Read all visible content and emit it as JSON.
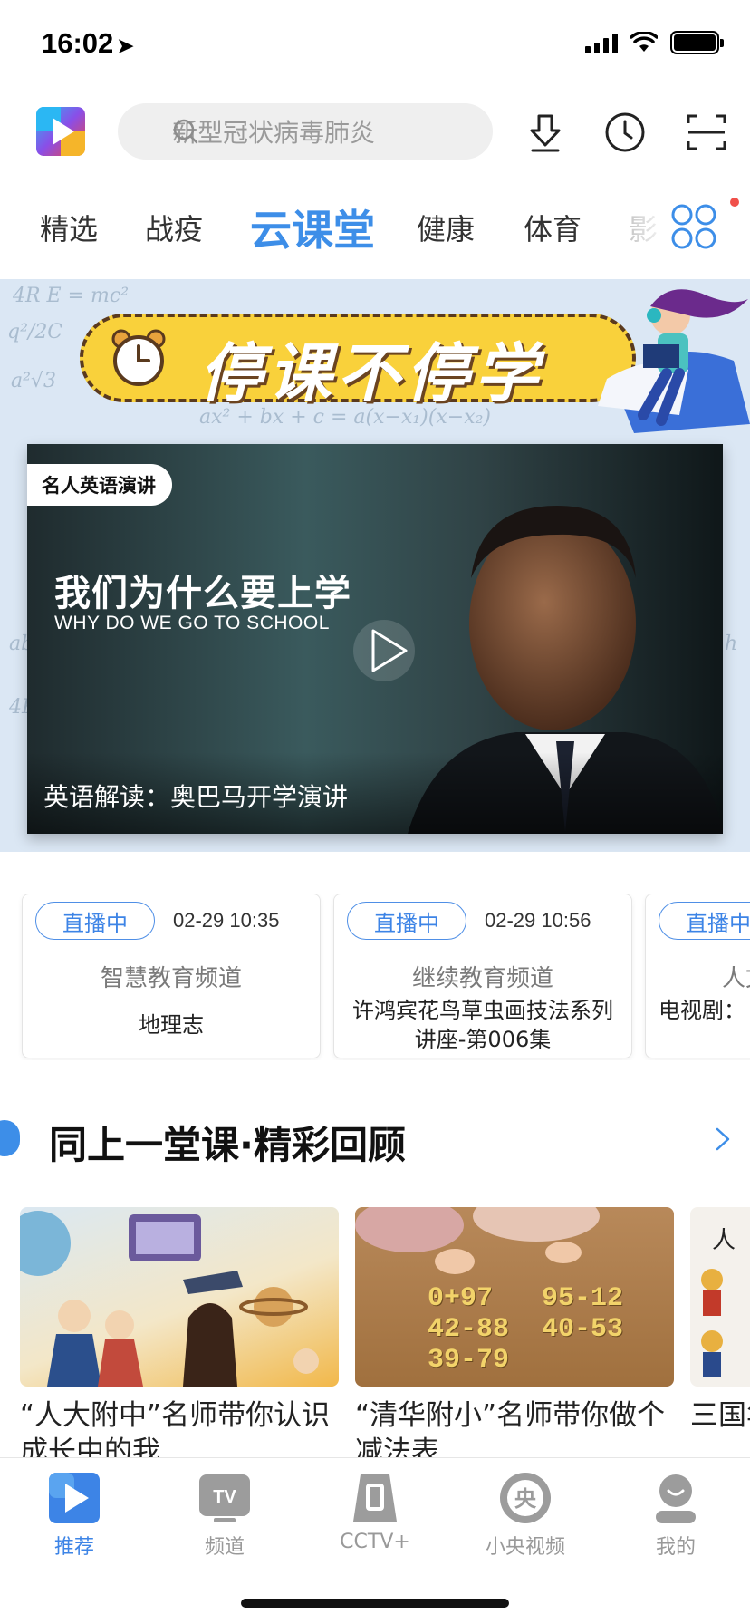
{
  "status_bar": {
    "time": "16:02",
    "location_arrow": "➤"
  },
  "header": {
    "search_placeholder": "新型冠状病毒肺炎",
    "icons": [
      "download-icon",
      "history-clock-icon",
      "scan-icon"
    ]
  },
  "tabs": [
    {
      "label": "精选"
    },
    {
      "label": "战疫"
    },
    {
      "label": "云课堂",
      "active": true
    },
    {
      "label": "健康"
    },
    {
      "label": "体育"
    },
    {
      "label": "影"
    }
  ],
  "banner": {
    "slogan": "停课不停学",
    "video": {
      "tag": "名人英语演讲",
      "title_cn": "我们为什么要上学",
      "title_en": "WHY DO WE GO TO SCHOOL",
      "caption": "英语解读：奥巴马开学演讲"
    }
  },
  "live": [
    {
      "badge": "直播中",
      "time": "02-29 10:35",
      "channel": "智慧教育频道",
      "show": "地理志"
    },
    {
      "badge": "直播中",
      "time": "02-29 10:56",
      "channel": "继续教育频道",
      "show": "许鸿宾花鸟草虫画技法系列讲座-第006集"
    },
    {
      "badge": "直播中",
      "time": "",
      "channel": "人文",
      "show": "电视剧："
    }
  ],
  "section": {
    "title": "同上一堂课·精彩回顾"
  },
  "review_cards": [
    {
      "title": "“人大附中”名师带你认识成长中的我"
    },
    {
      "title": "“清华附小”名师带你做个减法表"
    },
    {
      "title": "三国华阳"
    }
  ],
  "math_numbers": {
    "row1": "0+97   95-12",
    "row2": "42-88  40-53",
    "row3": "39-79"
  },
  "tabbar": [
    {
      "label": "推荐",
      "active": true
    },
    {
      "label": "频道"
    },
    {
      "label": "CCTV+"
    },
    {
      "label": "小央视频"
    },
    {
      "label": "我的"
    }
  ],
  "colors": {
    "accent": "#3d8ee8",
    "badge_text": "#3d84e6",
    "slogan_yellow": "#f9d13b"
  }
}
